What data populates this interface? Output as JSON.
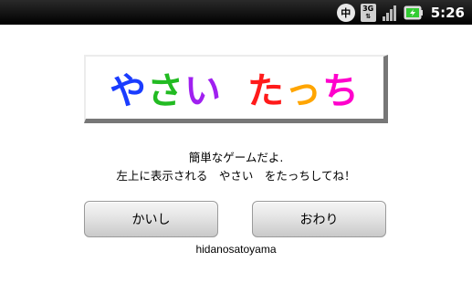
{
  "status_bar": {
    "ime_label": "中",
    "network_label": "3G",
    "time": "5:26",
    "icons": [
      "ime-icon",
      "network-3g-icon",
      "signal-icon",
      "battery-icon"
    ]
  },
  "title": {
    "chars": [
      "や",
      "さ",
      "い",
      "た",
      "っ",
      "ち"
    ],
    "colors": [
      "#1a3cff",
      "#22bb22",
      "#a020f0",
      "#ff1a1a",
      "#ffa500",
      "#ff00cc"
    ]
  },
  "message": {
    "line1": "簡単なゲームだよ.",
    "line2": "左上に表示される　やさい　をたっちしてね！"
  },
  "buttons": {
    "start_label": "かいし",
    "quit_label": "おわり"
  },
  "credit": "hidanosatoyama"
}
